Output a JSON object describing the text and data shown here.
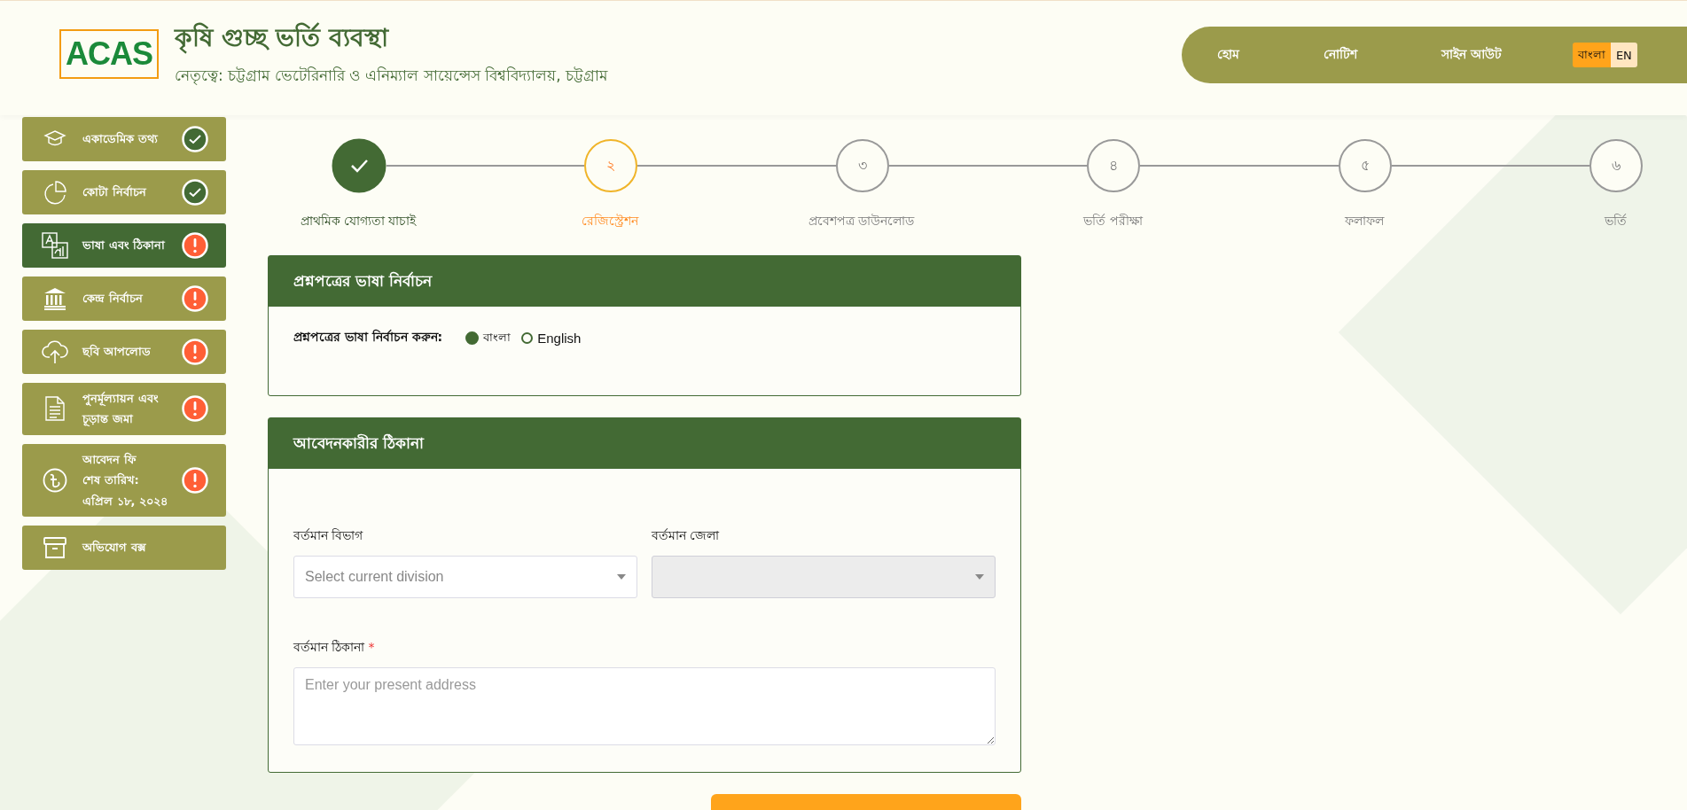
{
  "header": {
    "logo": "ACAS",
    "title": "কৃষি গুচ্ছ ভর্তি ব্যবস্থা",
    "subtitle": "নেতৃত্বে: চট্টগ্রাম ভেটেরিনারি ও এনিম্যাল সায়েন্সেস বিশ্ববিদ্যালয়, চট্টগ্রাম"
  },
  "nav": {
    "links": [
      "হোম",
      "নোটিশ",
      "সাইন আউট"
    ],
    "languages": [
      {
        "label": "বাংলা",
        "selected": true
      },
      {
        "label": "EN",
        "selected": false
      }
    ]
  },
  "sidebar": {
    "items": [
      {
        "lines": [
          "একাডেমিক তথ্য"
        ],
        "complete": true,
        "selected": false
      },
      {
        "lines": [
          "কোটা নির্বাচন"
        ],
        "complete": true,
        "selected": false
      },
      {
        "lines": [
          "ভাষা এবং ঠিকানা"
        ],
        "complete": false,
        "selected": true
      },
      {
        "lines": [
          "কেন্দ্র নির্বাচন"
        ],
        "complete": false,
        "selected": false
      },
      {
        "lines": [
          "ছবি আপলোড"
        ],
        "complete": false,
        "selected": false
      },
      {
        "lines": [
          "পুনর্মূল্যায়ন এবং চূড়ান্ত জমা"
        ],
        "complete": false,
        "selected": false
      },
      {
        "lines": [
          "আবেদন ফি",
          "শেষ তারিখ:",
          "এপ্রিল ১৮, ২০২৪"
        ],
        "complete": false,
        "selected": false
      },
      {
        "lines": [
          "অভিযোগ বক্স"
        ],
        "selected": false
      }
    ]
  },
  "stepper": {
    "steps": [
      {
        "label": "প্রাথমিক যোগ্যতা যাচাই",
        "done": true,
        "selected": false
      },
      {
        "number": "২",
        "label": "রেজিস্ট্রেশন",
        "done": false,
        "selected": true
      },
      {
        "number": "৩",
        "label": "প্রবেশপত্র ডাউনলোড",
        "done": false,
        "selected": false
      },
      {
        "number": "৪",
        "label": "ভর্তি পরীক্ষা",
        "done": false,
        "selected": false
      },
      {
        "number": "৫",
        "label": "ফলাফল",
        "done": false,
        "selected": false
      },
      {
        "number": "৬",
        "label": "ভর্তি",
        "done": false,
        "selected": false
      }
    ]
  },
  "language_card": {
    "title": "প্রশ্নপত্রের ভাষা নির্বাচন",
    "label": "প্রশ্নপত্রের ভাষা নির্বাচন করুন:",
    "options": [
      {
        "label": "বাংলা",
        "selected": true
      },
      {
        "label": "English",
        "selected": false
      }
    ]
  },
  "address_card": {
    "title": "আবেদনকারীর ঠিকানা",
    "division": {
      "label": "বর্তমান বিভাগ",
      "placeholder": "Select current division",
      "disabled": false
    },
    "district": {
      "label": "বর্তমান জেলা",
      "disabled": true
    },
    "address": {
      "label": "বর্তমান ঠিকানা",
      "required_mark": "*",
      "placeholder": "Enter your present address"
    }
  }
}
